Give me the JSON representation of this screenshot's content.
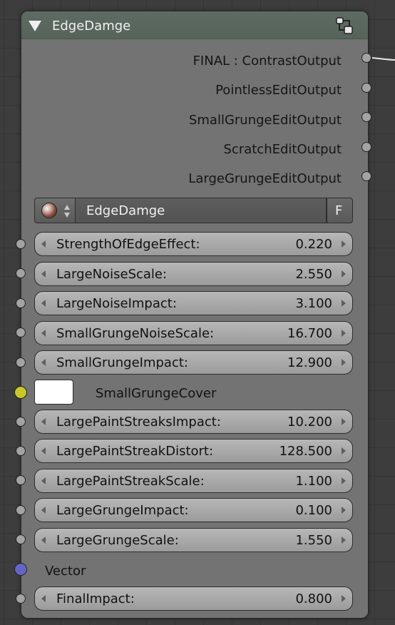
{
  "node": {
    "title": "EdgeDamge",
    "icons": {
      "collapse": "triangle-down-icon",
      "group": "node-group-icon"
    },
    "colors": {
      "header": "#5d6c63",
      "body": "#737373",
      "socket_float": "#a3a3a3",
      "socket_color": "#c7c729",
      "socket_vector": "#6565c6"
    }
  },
  "outputs": [
    {
      "label": "FINAL : ContrastOutput"
    },
    {
      "label": "PointlessEditOutput"
    },
    {
      "label": "SmallGrungeEditOutput"
    },
    {
      "label": "ScratchEditOutput"
    },
    {
      "label": "LargeGrungeEditOutput"
    }
  ],
  "group_selector": {
    "name": "EdgeDamge",
    "fake_user": "F"
  },
  "inputs": {
    "strength": {
      "label": "StrengthOfEdgeEffect:",
      "value": "0.220"
    },
    "large_noise_scale": {
      "label": "LargeNoiseScale:",
      "value": "2.550"
    },
    "large_noise_impact": {
      "label": "LargeNoiseImpact:",
      "value": "3.100"
    },
    "small_grunge_noise_scale": {
      "label": "SmallGrungeNoiseScale:",
      "value": "16.700"
    },
    "small_grunge_impact": {
      "label": "SmallGrungeImpact:",
      "value": "12.900"
    },
    "small_grunge_cover": {
      "label": "SmallGrungeCover",
      "color": "#ffffff"
    },
    "large_paint_streaks_impact": {
      "label": "LargePaintStreaksImpact:",
      "value": "10.200"
    },
    "large_paint_streak_distort": {
      "label": "LargePaintStreakDistort:",
      "value": "128.500"
    },
    "large_paint_streak_scale": {
      "label": "LargePaintStreakScale:",
      "value": "1.100"
    },
    "large_grunge_impact": {
      "label": "LargeGrungeImpact:",
      "value": "0.100"
    },
    "large_grunge_scale": {
      "label": "LargeGrungeScale:",
      "value": "1.550"
    },
    "vector": {
      "label": "Vector"
    },
    "final_impact": {
      "label": "FinalImpact:",
      "value": "0.800"
    }
  }
}
